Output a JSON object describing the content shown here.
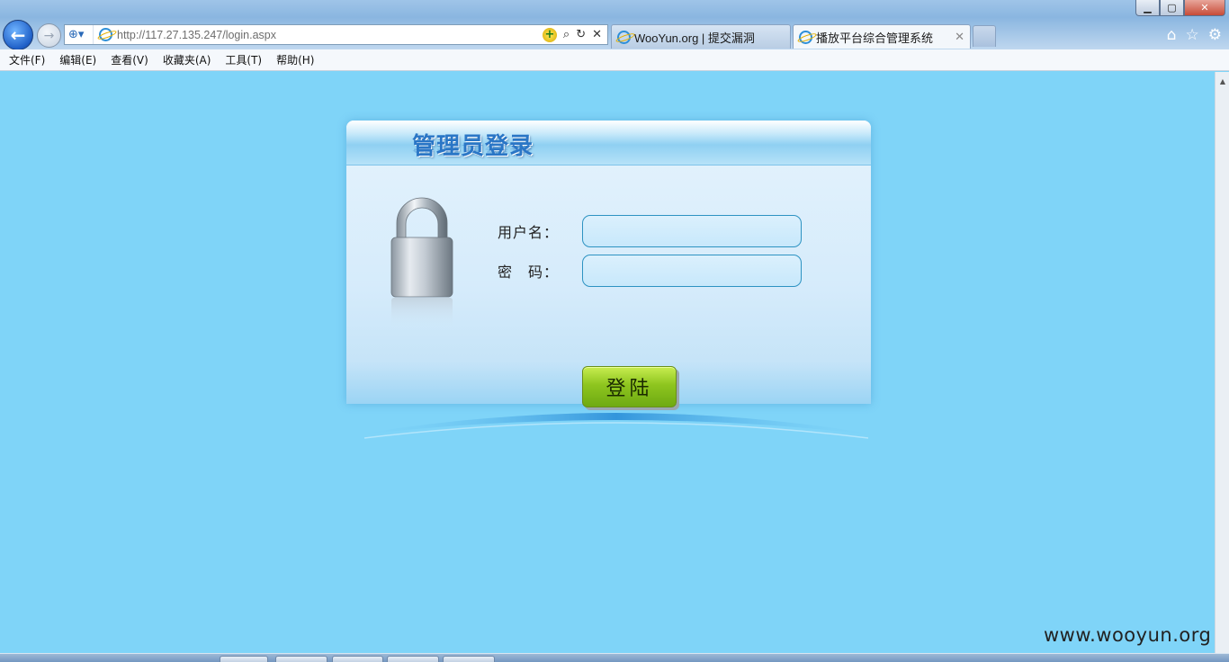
{
  "browser": {
    "url_host": "http://117.27.135.247",
    "url_path": "/login.aspx",
    "tabs": [
      {
        "title": "WooYun.org | 提交漏洞",
        "active": false
      },
      {
        "title": "播放平台综合管理系统",
        "active": true
      }
    ],
    "tab_close": "✕",
    "window_controls": {
      "minimize": "▁",
      "maximize": "▢",
      "close": "✕"
    },
    "nav": {
      "back": "←",
      "forward": "→"
    },
    "address_tools": {
      "plus": "+",
      "search": "⌕",
      "refresh": "↻",
      "stop": "✕",
      "compat": "⊕▾"
    },
    "right_icons": {
      "home": "⌂",
      "favorites": "☆",
      "settings": "⚙"
    }
  },
  "menubar": {
    "items": [
      "文件(F)",
      "编辑(E)",
      "查看(V)",
      "收藏夹(A)",
      "工具(T)",
      "帮助(H)"
    ]
  },
  "login": {
    "title": "管理员登录",
    "username_label": "用户名：",
    "password_label": "密　码：",
    "username_value": "",
    "password_value": "",
    "submit_label": "登陆"
  },
  "colors": {
    "page_background": "#7fd4f8",
    "title_blue": "#2a76c6",
    "button_green": "#8ec51f",
    "input_border": "#2d93c2"
  },
  "watermark": "www.wooyun.org"
}
